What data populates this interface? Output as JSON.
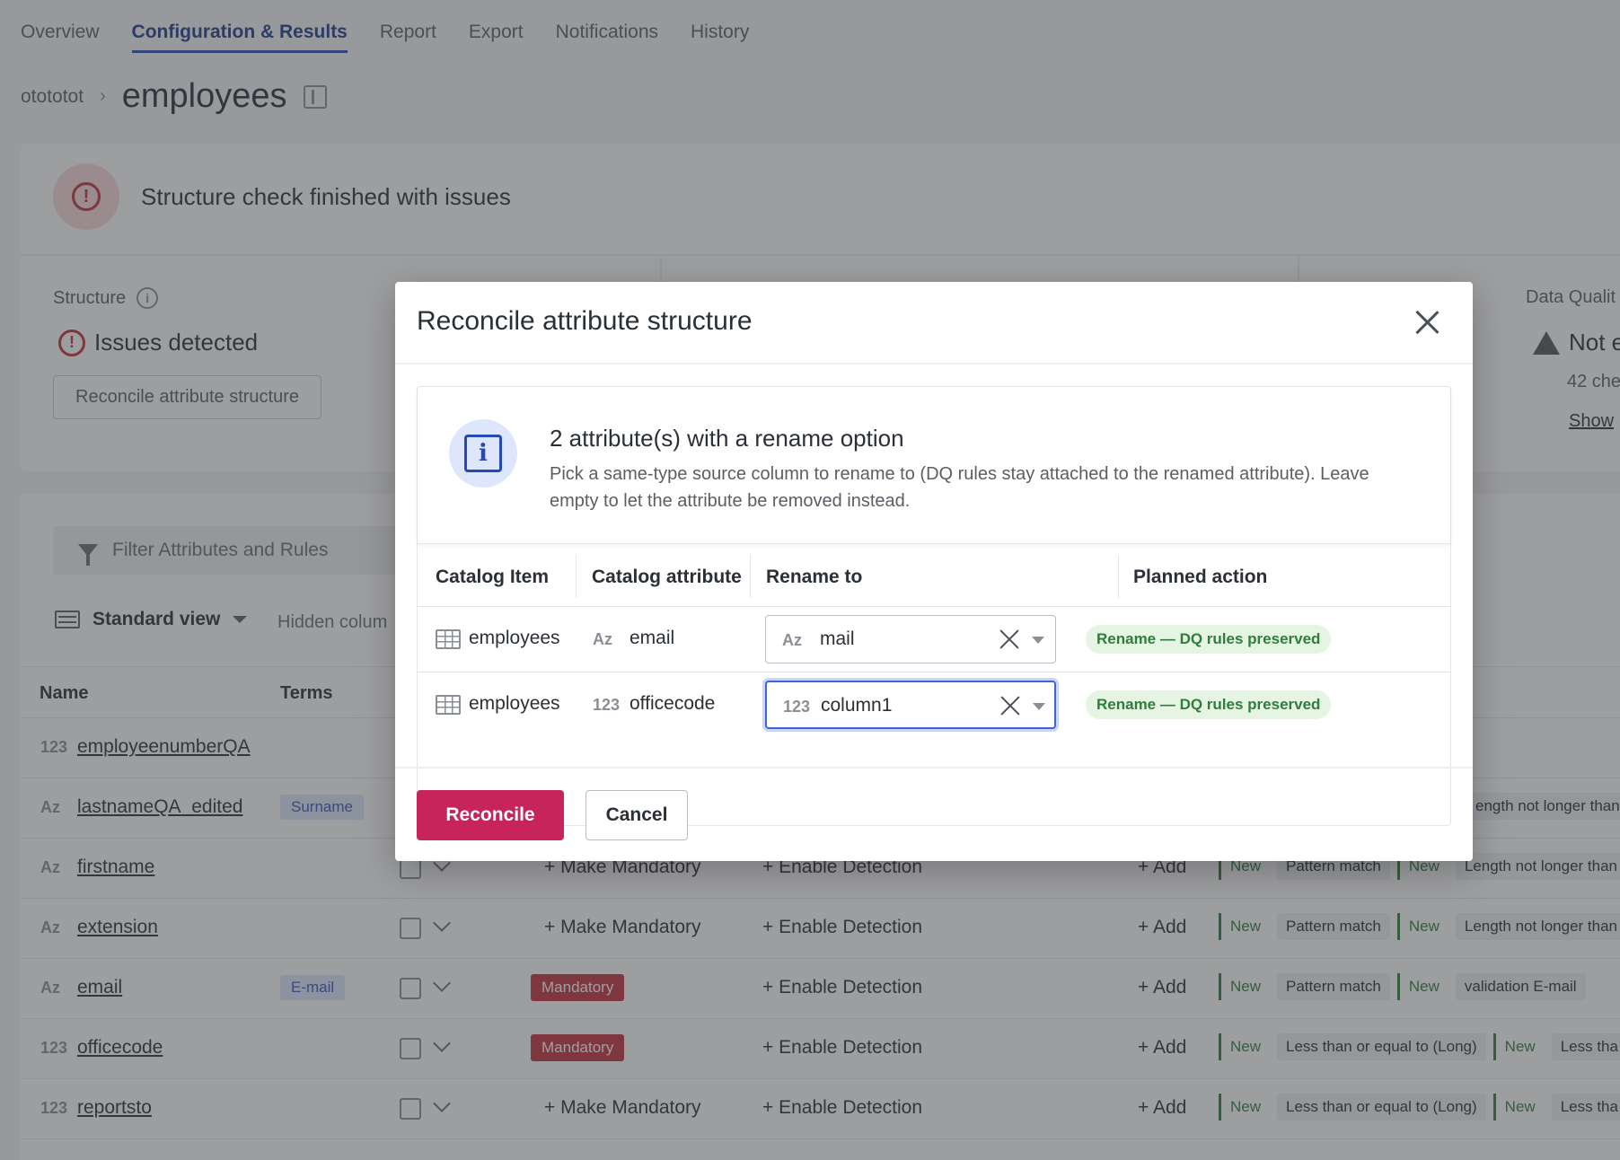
{
  "tabs": [
    "Overview",
    "Configuration & Results",
    "Report",
    "Export",
    "Notifications",
    "History"
  ],
  "breadcrumb": {
    "parent": "otototot",
    "title": "employees"
  },
  "status": {
    "message": "Structure check finished with issues"
  },
  "structure": {
    "label": "Structure",
    "state": "Issues detected",
    "button": "Reconcile attribute structure"
  },
  "data_quality": {
    "label": "Data Qualit",
    "state": "Not e",
    "sub": "42 che",
    "link": "Show"
  },
  "grid": {
    "filter_placeholder": "Filter Attributes and Rules",
    "view": "Standard view",
    "hidden_columns": "Hidden colum",
    "headers": {
      "name": "Name",
      "terms": "Terms"
    },
    "make_mandatory": "+ Make Mandatory",
    "enable_detection": "+ Enable Detection",
    "add": "+ Add",
    "mandatory": "Mandatory",
    "new": "New",
    "rows": [
      {
        "type": "123",
        "name": "employeenumberQA",
        "term": ""
      },
      {
        "type": "Az",
        "name": "lastnameQA_edited",
        "term": "Surname",
        "rules": [
          "ength not longer than"
        ]
      },
      {
        "type": "Az",
        "name": "firstname",
        "term": "",
        "rules": [
          "Pattern match",
          "Length not longer than"
        ]
      },
      {
        "type": "Az",
        "name": "extension",
        "term": "",
        "rules": [
          "Pattern match",
          "Length not longer than"
        ]
      },
      {
        "type": "Az",
        "name": "email",
        "term": "E-mail",
        "rules": [
          "Pattern match",
          "validation E-mail"
        ]
      },
      {
        "type": "123",
        "name": "officecode",
        "term": "",
        "rules": [
          "Less than or equal to (Long)",
          "Less tha"
        ]
      },
      {
        "type": "123",
        "name": "reportsto",
        "term": "",
        "rules": [
          "Less than or equal to (Long)",
          "Less tha"
        ]
      }
    ]
  },
  "modal": {
    "title": "Reconcile attribute structure",
    "info_heading": "2 attribute(s) with a rename option",
    "info_body": "Pick a same-type source column to rename to (DQ rules stay attached to the renamed attribute). Leave empty to let the attribute be removed instead.",
    "columns": [
      "Catalog Item",
      "Catalog attribute",
      "Rename to",
      "Planned action"
    ],
    "rows": [
      {
        "item": "employees",
        "attr_type": "Az",
        "attribute": "email",
        "rename_type": "Az",
        "rename_to": "mail",
        "action": "Rename — DQ rules preserved"
      },
      {
        "item": "employees",
        "attr_type": "123",
        "attribute": "officecode",
        "rename_type": "123",
        "rename_to": "column1",
        "action": "Rename — DQ rules preserved"
      }
    ],
    "reconcile": "Reconcile",
    "cancel": "Cancel"
  }
}
